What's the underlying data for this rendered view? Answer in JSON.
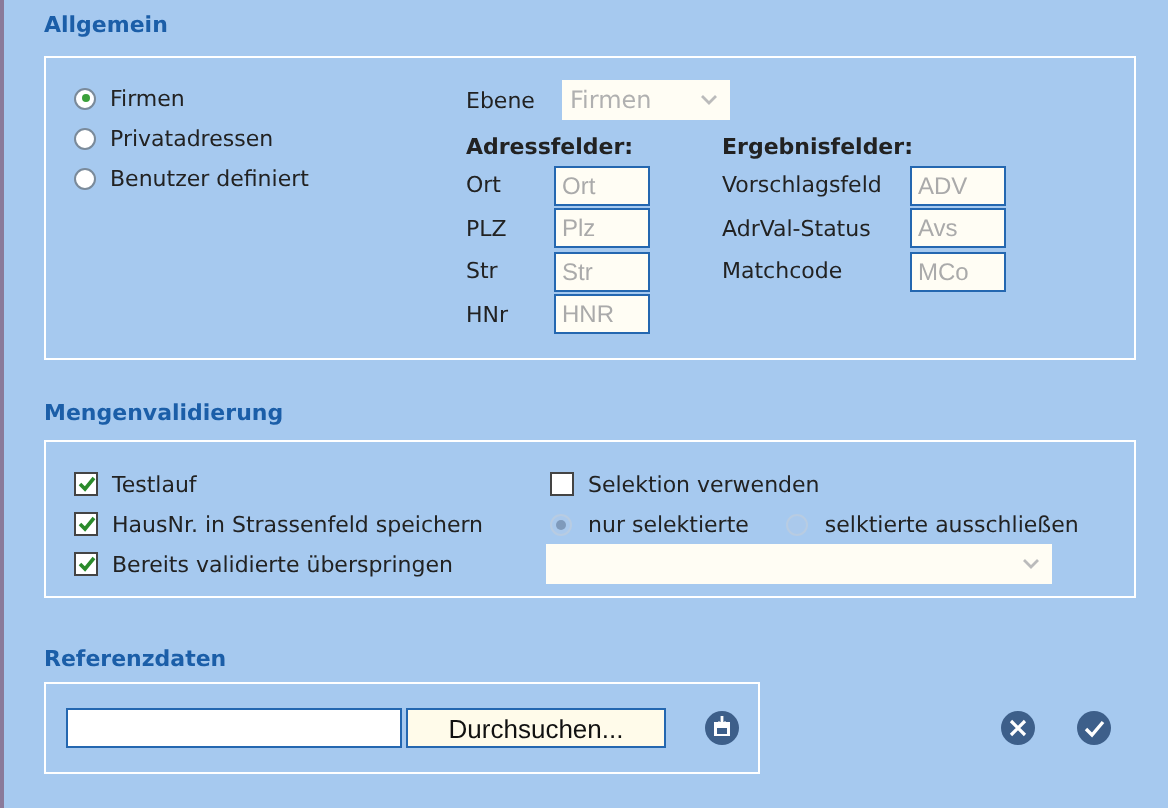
{
  "allgemein": {
    "title": "Allgemein",
    "radios": [
      {
        "label": "Firmen",
        "selected": true
      },
      {
        "label": "Privatadressen",
        "selected": false
      },
      {
        "label": "Benutzer definiert",
        "selected": false
      }
    ],
    "ebene": {
      "label": "Ebene",
      "value": "Firmen",
      "disabled": true
    },
    "address_fields": {
      "heading": "Adressfelder:",
      "fields": [
        {
          "label": "Ort",
          "placeholder": "Ort"
        },
        {
          "label": "PLZ",
          "placeholder": "Plz"
        },
        {
          "label": "Str",
          "placeholder": "Str"
        },
        {
          "label": "HNr",
          "placeholder": "HNR"
        }
      ]
    },
    "result_fields": {
      "heading": "Ergebnisfelder:",
      "fields": [
        {
          "label": "Vorschlagsfeld",
          "placeholder": "ADV"
        },
        {
          "label": "AdrVal-Status",
          "placeholder": "Avs"
        },
        {
          "label": "Matchcode",
          "placeholder": "MCo"
        }
      ]
    }
  },
  "mengenvalidierung": {
    "title": "Mengenvalidierung",
    "checkboxes": [
      {
        "label": "Testlauf",
        "checked": true
      },
      {
        "label": "HausNr. in Strassenfeld speichern",
        "checked": true
      },
      {
        "label": "Bereits validierte überspringen",
        "checked": true
      }
    ],
    "selection": {
      "label": "Selektion verwenden",
      "checked": false
    },
    "selection_radios": [
      {
        "label": "nur selektierte",
        "selected": true,
        "disabled": true
      },
      {
        "label": "selktierte ausschließen",
        "selected": false,
        "disabled": true
      }
    ]
  },
  "referenzdaten": {
    "title": "Referenzdaten",
    "browse_button": "Durchsuchen..."
  }
}
